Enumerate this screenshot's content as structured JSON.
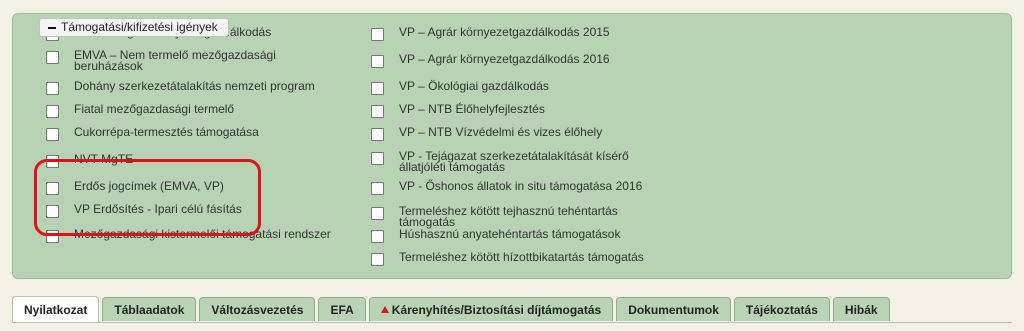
{
  "panel": {
    "legend": "Támogatási/kifizetési igények",
    "left_items": [
      {
        "label": "EMVA – Agrár környezetgazdálkodás"
      },
      {
        "label": "EMVA – Nem termelő mezőgazdasági beruházások"
      },
      {
        "label": "Dohány szerkezetátalakítás nemzeti program"
      },
      {
        "label": "Fiatal mezőgazdasági termelő"
      },
      {
        "label": "Cukorrépa-termesztés támogatása"
      },
      {
        "label": "NVT MgTE"
      },
      {
        "label": "Erdős jogcímek (EMVA, VP)"
      },
      {
        "label": "VP Erdősítés - Ipari célú fásítás"
      },
      {
        "label": "Mezőgazdasági kistermelői támogatási rendszer"
      }
    ],
    "right_items": [
      {
        "label": "VP – Agrár környezetgazdálkodás 2015"
      },
      {
        "label": "VP – Agrár környezetgazdálkodás 2016"
      },
      {
        "label": "VP – Ökológiai gazdálkodás"
      },
      {
        "label": "VP – NTB Élőhelyfejlesztés"
      },
      {
        "label": "VP – NTB Vízvédelmi és vizes élőhely"
      },
      {
        "label": "VP - Tejágazat szerkezetátalakítását kísérő állatjóléti támogatás"
      },
      {
        "label": "VP - Őshonos állatok in situ támogatása 2016"
      },
      {
        "label": "Termeléshez kötött tejhasznú tehéntartás támogatás"
      },
      {
        "label": "Húshasznú anyatehéntartás támogatások"
      },
      {
        "label": "Termeléshez kötött hízottbikatartás támogatás"
      }
    ]
  },
  "tabs": [
    {
      "label": "Nyilatkozat",
      "active": true
    },
    {
      "label": "Táblaadatok"
    },
    {
      "label": "Változásvezetés"
    },
    {
      "label": "EFA"
    },
    {
      "label": "Kárenyhítés/Biztosítási díjtámogatás",
      "icon": "warning-icon"
    },
    {
      "label": "Dokumentumok"
    },
    {
      "label": "Tájékoztatás"
    },
    {
      "label": "Hibák"
    }
  ]
}
